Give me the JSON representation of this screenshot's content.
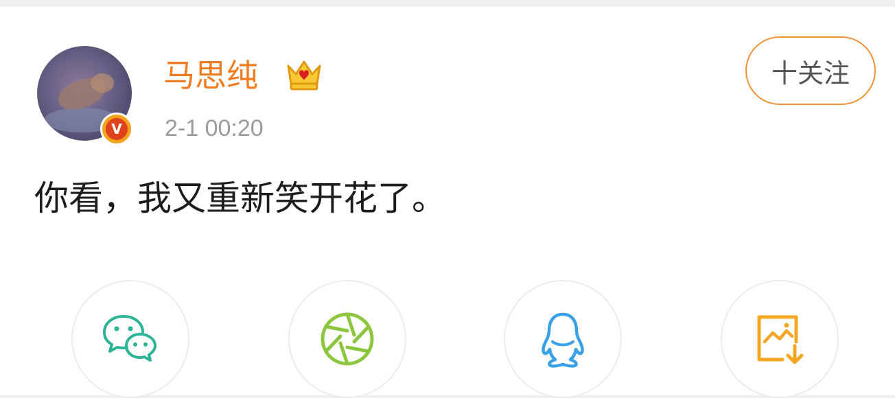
{
  "post": {
    "author": {
      "name": "马思纯",
      "verified_badge": "V",
      "crown_icon": "crown-icon"
    },
    "timestamp": "2-1 00:20",
    "follow_label": "十关注",
    "text": "你看，我又重新笑开花了。"
  },
  "share_options": [
    {
      "icon": "wechat-icon",
      "color": "#2bb596"
    },
    {
      "icon": "moments-aperture-icon",
      "color": "#8cc63e"
    },
    {
      "icon": "qq-penguin-icon",
      "color": "#3aa1e6"
    },
    {
      "icon": "save-image-icon",
      "color": "#f5a623"
    }
  ],
  "colors": {
    "username": "#f07c22",
    "follow_border": "#f29335",
    "timestamp": "#9b9b9b",
    "text": "#1c1c1c"
  }
}
